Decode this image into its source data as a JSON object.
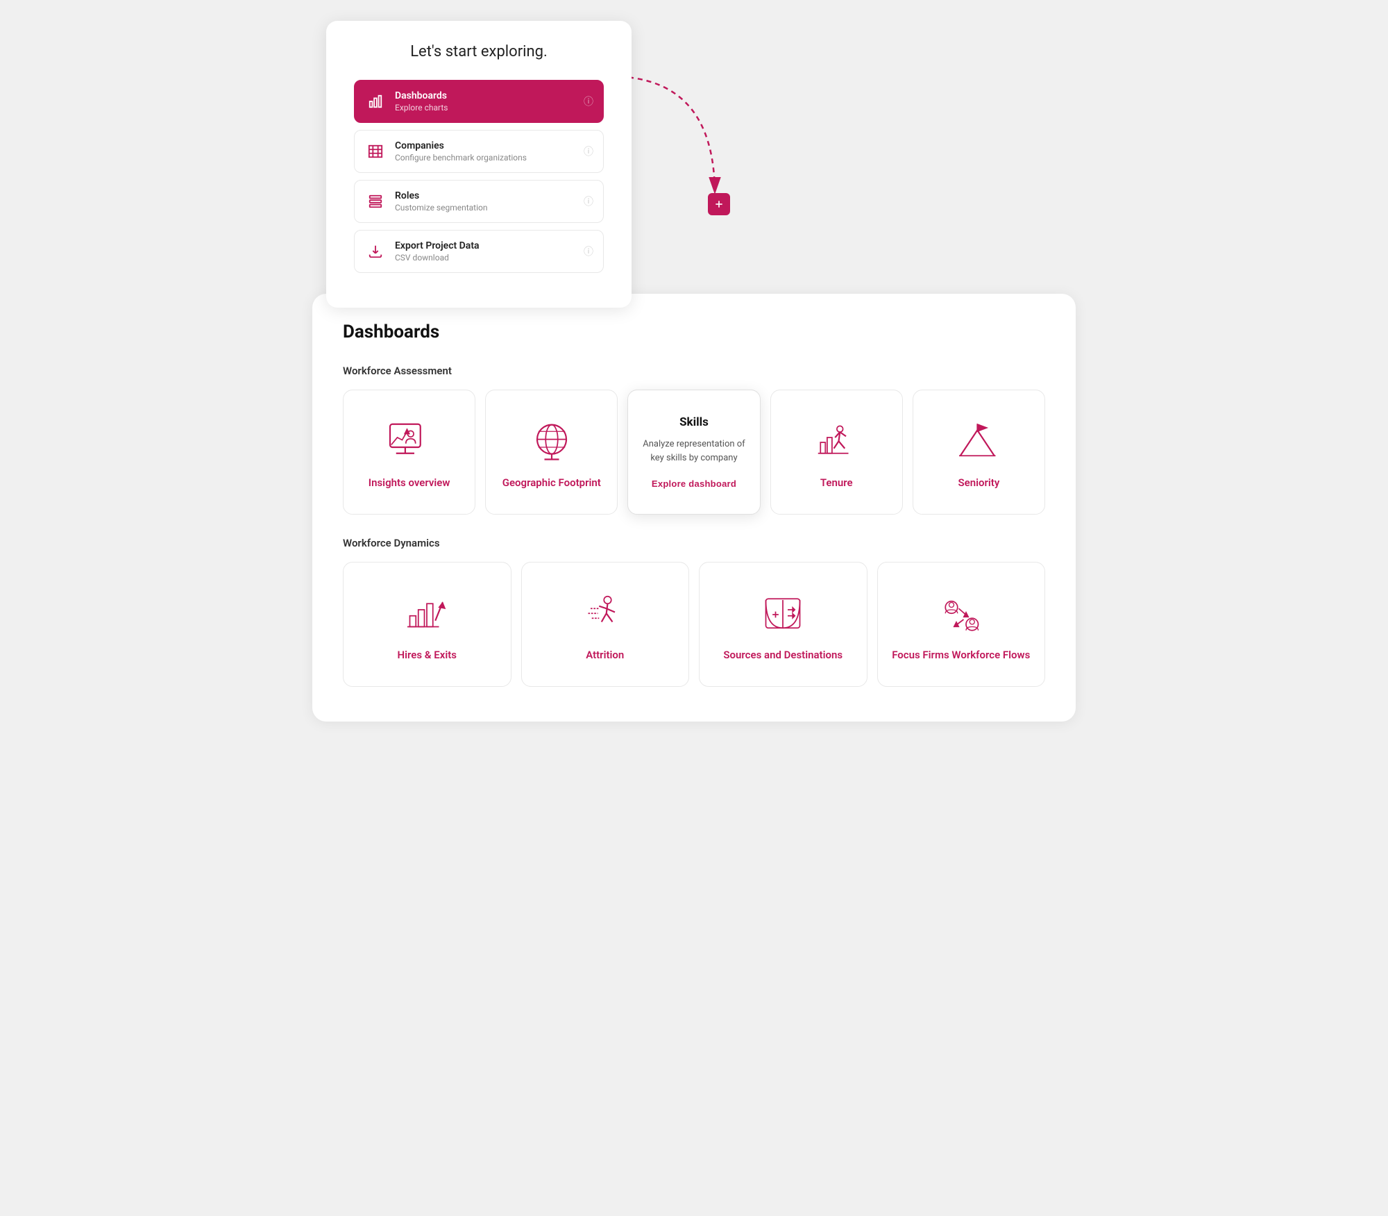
{
  "popup": {
    "title": "Let's start exploring.",
    "items": [
      {
        "id": "dashboards",
        "title": "Dashboards",
        "subtitle": "Explore charts",
        "active": true,
        "icon": "chart"
      },
      {
        "id": "companies",
        "title": "Companies",
        "subtitle": "Configure benchmark organizations",
        "active": false,
        "icon": "building"
      },
      {
        "id": "roles",
        "title": "Roles",
        "subtitle": "Customize segmentation",
        "active": false,
        "icon": "users"
      },
      {
        "id": "export",
        "title": "Export Project Data",
        "subtitle": "CSV download",
        "active": false,
        "icon": "download"
      }
    ]
  },
  "dashboard": {
    "title": "Dashboards",
    "sections": [
      {
        "label": "Workforce Assessment",
        "cards": [
          {
            "id": "insights-overview",
            "label": "Insights overview",
            "featured": false,
            "icon": "insights"
          },
          {
            "id": "geographic-footprint",
            "label": "Geographic Footprint",
            "featured": false,
            "icon": "globe"
          },
          {
            "id": "skills",
            "label": "Skills",
            "featured": true,
            "description": "Analyze representation of key skills by company",
            "explore_label": "Explore dashboard",
            "icon": "skills"
          },
          {
            "id": "tenure",
            "label": "Tenure",
            "featured": false,
            "icon": "tenure"
          },
          {
            "id": "seniority",
            "label": "Seniority",
            "featured": false,
            "icon": "seniority"
          }
        ]
      },
      {
        "label": "Workforce Dynamics",
        "cards": [
          {
            "id": "hires-exits",
            "label": "Hires & Exits",
            "featured": false,
            "icon": "hires"
          },
          {
            "id": "attrition",
            "label": "Attrition",
            "featured": false,
            "icon": "attrition"
          },
          {
            "id": "sources-destinations",
            "label": "Sources and Destinations",
            "featured": false,
            "icon": "sources"
          },
          {
            "id": "focus-firms",
            "label": "Focus Firms Workforce Flows",
            "featured": false,
            "icon": "focusfirms"
          }
        ]
      }
    ]
  }
}
